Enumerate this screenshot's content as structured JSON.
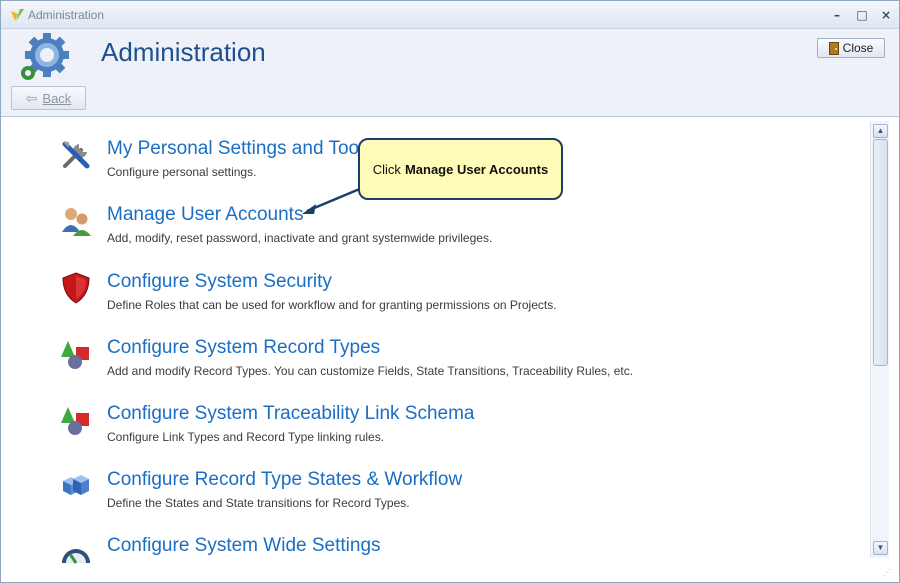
{
  "window": {
    "title": "Administration",
    "minimize_glyph": "–",
    "maximize_glyph": "□",
    "close_glyph": "×"
  },
  "header": {
    "page_title": "Administration",
    "close_label": "Close",
    "back_label": "Back",
    "back_glyph": "⇦"
  },
  "items": [
    {
      "title": "My Personal Settings and Too",
      "description": "Configure personal settings.",
      "icon": "tools-icon"
    },
    {
      "title": "Manage User Accounts",
      "description": "Add, modify, reset password, inactivate and grant systemwide privileges.",
      "icon": "users-icon"
    },
    {
      "title": "Configure System Security",
      "description": "Define Roles that can be used for workflow and for granting permissions on Projects.",
      "icon": "shield-icon"
    },
    {
      "title": "Configure System Record Types",
      "description": "Add and modify Record Types. You can customize Fields, State Transitions, Traceability Rules, etc.",
      "icon": "shapes-icon"
    },
    {
      "title": "Configure System Traceability Link Schema",
      "description": "Configure Link Types and Record Type linking rules.",
      "icon": "shapes-icon"
    },
    {
      "title": "Configure Record Type States & Workflow",
      "description": "Define the States and State transitions for Record Types.",
      "icon": "cubes-icon"
    },
    {
      "title": "Configure System Wide Settings",
      "description": "",
      "icon": "gauge-icon"
    }
  ],
  "callout": {
    "prefix": "Click",
    "emphasis": "Manage User Accounts"
  },
  "colors": {
    "link_blue": "#1a6ec4",
    "title_blue": "#1f4f8f",
    "callout_bg": "#fffbb8",
    "callout_border": "#1c3e6b"
  }
}
